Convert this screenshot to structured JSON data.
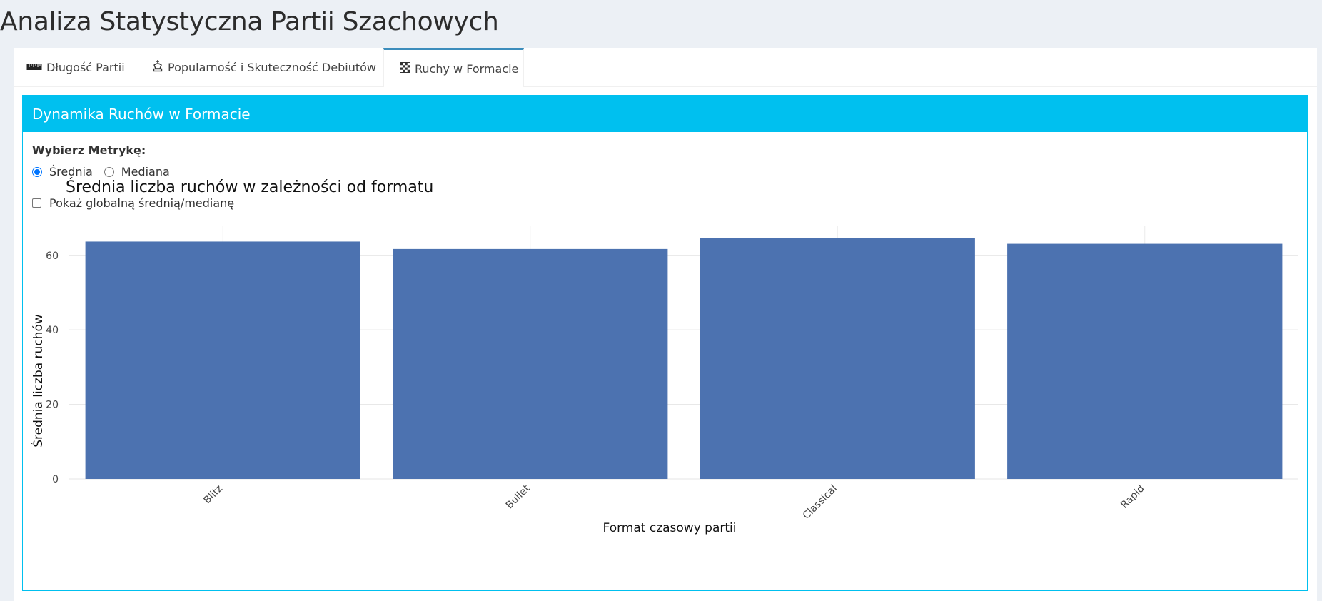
{
  "page": {
    "title": "Analiza Statystyczna Partii Szachowych"
  },
  "tabs": [
    {
      "label": "Długość Partii",
      "icon": "ruler-icon",
      "active": false
    },
    {
      "label": "Popularność i Skuteczność Debiutów",
      "icon": "chess-king-icon",
      "active": false
    },
    {
      "label": "Ruchy w Formacie",
      "icon": "chessboard-icon",
      "active": true
    }
  ],
  "panel": {
    "title": "Dynamika Ruchów w Formacie",
    "metric_label": "Wybierz Metrykę:",
    "options": [
      {
        "label": "Średnia",
        "checked": true
      },
      {
        "label": "Mediana",
        "checked": false
      }
    ],
    "checkbox_label": "Pokaż globalną średnią/medianę",
    "checkbox_checked": false
  },
  "colors": {
    "accent": "#00c0ef",
    "bar": "#4c72b0",
    "tab_active_border": "#3c8dbc"
  },
  "chart_data": {
    "type": "bar",
    "title": "Średnia liczba ruchów w zależności od formatu",
    "xlabel": "Format czasowy partii",
    "ylabel": "Średnia liczba ruchów",
    "categories": [
      "Blitz",
      "Bullet",
      "Classical",
      "Rapid"
    ],
    "values": [
      63.7,
      61.7,
      64.7,
      63.1
    ],
    "ylim": [
      0,
      68
    ],
    "yticks": [
      0,
      20,
      40,
      60
    ],
    "grid": true,
    "legend": "none"
  }
}
